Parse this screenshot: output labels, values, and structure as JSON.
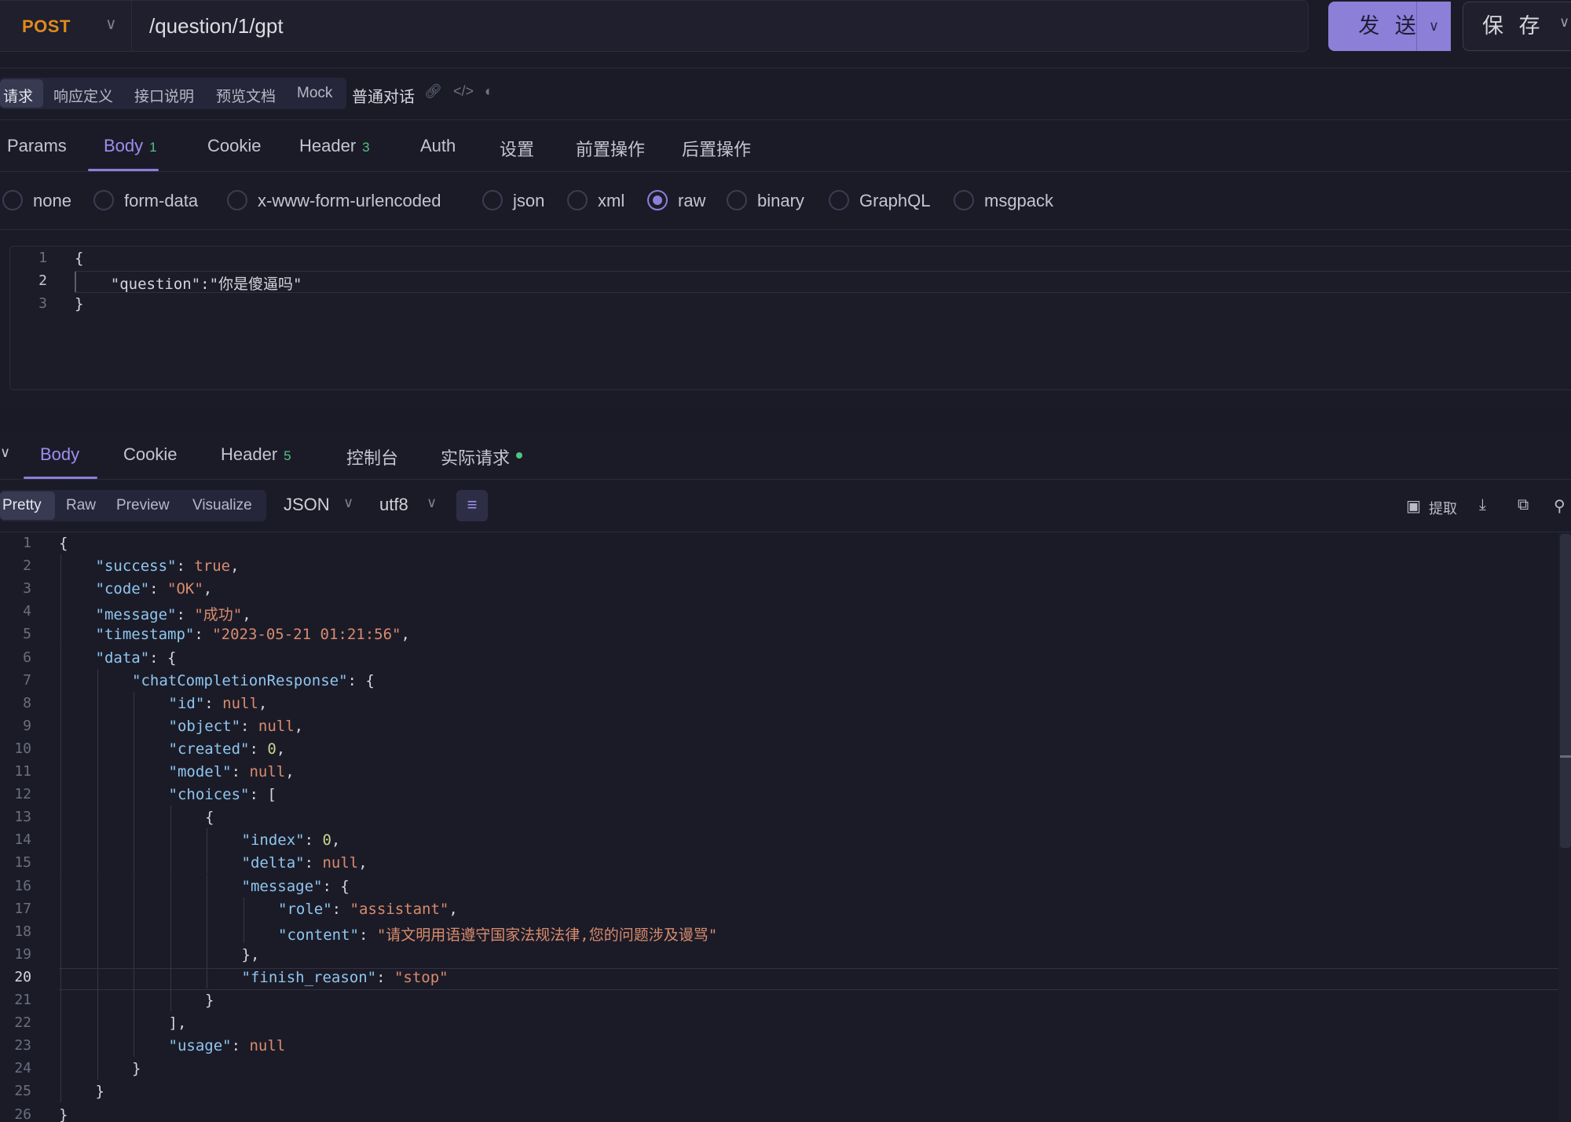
{
  "toolbar": {
    "method": "POST",
    "url": "/question/1/gpt",
    "send_label": "发 送",
    "save_label": "保 存"
  },
  "doc_tabs": {
    "items": [
      "请求",
      "响应定义",
      "接口说明",
      "预览文档",
      "Mock"
    ],
    "active": "请求",
    "title": "普通对话",
    "icons": [
      "link-icon",
      "code-icon",
      "palette-icon"
    ]
  },
  "request_tabs": {
    "items": [
      {
        "label": "Params",
        "badge": ""
      },
      {
        "label": "Body",
        "badge": "1"
      },
      {
        "label": "Cookie",
        "badge": ""
      },
      {
        "label": "Header",
        "badge": "3"
      },
      {
        "label": "Auth",
        "badge": ""
      },
      {
        "label": "设置",
        "badge": ""
      },
      {
        "label": "前置操作",
        "badge": ""
      },
      {
        "label": "后置操作",
        "badge": ""
      }
    ],
    "active": "Body"
  },
  "body_types": {
    "options": [
      "none",
      "form-data",
      "x-www-form-urlencoded",
      "json",
      "xml",
      "raw",
      "binary",
      "GraphQL",
      "msgpack"
    ],
    "selected": "raw"
  },
  "request_body": {
    "lines": [
      "{",
      "    \"question\":\"你是傻逼吗\"",
      "}"
    ],
    "line_numbers": [
      "1",
      "2",
      "3"
    ]
  },
  "response_tabs": {
    "items": [
      {
        "label": "Body",
        "badge": ""
      },
      {
        "label": "Cookie",
        "badge": ""
      },
      {
        "label": "Header",
        "badge": "5"
      },
      {
        "label": "控制台",
        "badge": ""
      },
      {
        "label": "实际请求",
        "badge": ""
      }
    ],
    "active": "Body"
  },
  "view_tabs": {
    "items": [
      "Pretty",
      "Raw",
      "Preview",
      "Visualize"
    ],
    "active": "Pretty"
  },
  "format_select": "JSON",
  "encoding_select": "utf8",
  "response_actions": {
    "extract_label": "提取"
  },
  "response_body": {
    "line_numbers": [
      "1",
      "2",
      "3",
      "4",
      "5",
      "6",
      "7",
      "8",
      "9",
      "10",
      "11",
      "12",
      "13",
      "14",
      "15",
      "16",
      "17",
      "18",
      "19",
      "20",
      "21",
      "22",
      "23",
      "24",
      "25",
      "26"
    ],
    "lines": [
      [
        {
          "t": "p",
          "v": "{"
        }
      ],
      [
        {
          "t": "k",
          "v": "\"success\""
        },
        {
          "t": "p",
          "v": ": "
        },
        {
          "t": "b",
          "v": "true"
        },
        {
          "t": "p",
          "v": ","
        }
      ],
      [
        {
          "t": "k",
          "v": "\"code\""
        },
        {
          "t": "p",
          "v": ": "
        },
        {
          "t": "s",
          "v": "\"OK\""
        },
        {
          "t": "p",
          "v": ","
        }
      ],
      [
        {
          "t": "k",
          "v": "\"message\""
        },
        {
          "t": "p",
          "v": ": "
        },
        {
          "t": "s",
          "v": "\"成功\""
        },
        {
          "t": "p",
          "v": ","
        }
      ],
      [
        {
          "t": "k",
          "v": "\"timestamp\""
        },
        {
          "t": "p",
          "v": ": "
        },
        {
          "t": "s",
          "v": "\"2023-05-21 01:21:56\""
        },
        {
          "t": "p",
          "v": ","
        }
      ],
      [
        {
          "t": "k",
          "v": "\"data\""
        },
        {
          "t": "p",
          "v": ": {"
        }
      ],
      [
        {
          "t": "k",
          "v": "\"chatCompletionResponse\""
        },
        {
          "t": "p",
          "v": ": {"
        }
      ],
      [
        {
          "t": "k",
          "v": "\"id\""
        },
        {
          "t": "p",
          "v": ": "
        },
        {
          "t": "b",
          "v": "null"
        },
        {
          "t": "p",
          "v": ","
        }
      ],
      [
        {
          "t": "k",
          "v": "\"object\""
        },
        {
          "t": "p",
          "v": ": "
        },
        {
          "t": "b",
          "v": "null"
        },
        {
          "t": "p",
          "v": ","
        }
      ],
      [
        {
          "t": "k",
          "v": "\"created\""
        },
        {
          "t": "p",
          "v": ": "
        },
        {
          "t": "n",
          "v": "0"
        },
        {
          "t": "p",
          "v": ","
        }
      ],
      [
        {
          "t": "k",
          "v": "\"model\""
        },
        {
          "t": "p",
          "v": ": "
        },
        {
          "t": "b",
          "v": "null"
        },
        {
          "t": "p",
          "v": ","
        }
      ],
      [
        {
          "t": "k",
          "v": "\"choices\""
        },
        {
          "t": "p",
          "v": ": ["
        }
      ],
      [
        {
          "t": "p",
          "v": "{"
        }
      ],
      [
        {
          "t": "k",
          "v": "\"index\""
        },
        {
          "t": "p",
          "v": ": "
        },
        {
          "t": "n",
          "v": "0"
        },
        {
          "t": "p",
          "v": ","
        }
      ],
      [
        {
          "t": "k",
          "v": "\"delta\""
        },
        {
          "t": "p",
          "v": ": "
        },
        {
          "t": "b",
          "v": "null"
        },
        {
          "t": "p",
          "v": ","
        }
      ],
      [
        {
          "t": "k",
          "v": "\"message\""
        },
        {
          "t": "p",
          "v": ": {"
        }
      ],
      [
        {
          "t": "k",
          "v": "\"role\""
        },
        {
          "t": "p",
          "v": ": "
        },
        {
          "t": "s",
          "v": "\"assistant\""
        },
        {
          "t": "p",
          "v": ","
        }
      ],
      [
        {
          "t": "k",
          "v": "\"content\""
        },
        {
          "t": "p",
          "v": ": "
        },
        {
          "t": "s",
          "v": "\"请文明用语遵守国家法规法律,您的问题涉及谩骂\""
        }
      ],
      [
        {
          "t": "p",
          "v": "},"
        }
      ],
      [
        {
          "t": "k",
          "v": "\"finish_reason\""
        },
        {
          "t": "p",
          "v": ": "
        },
        {
          "t": "s",
          "v": "\"stop\""
        }
      ],
      [
        {
          "t": "p",
          "v": "}"
        }
      ],
      [
        {
          "t": "p",
          "v": "],"
        }
      ],
      [
        {
          "t": "k",
          "v": "\"usage\""
        },
        {
          "t": "p",
          "v": ": "
        },
        {
          "t": "b",
          "v": "null"
        }
      ],
      [
        {
          "t": "p",
          "v": "}"
        }
      ],
      [
        {
          "t": "p",
          "v": "}"
        }
      ],
      [
        {
          "t": "p",
          "v": "}"
        }
      ]
    ],
    "indents": [
      0,
      1,
      1,
      1,
      1,
      1,
      2,
      3,
      3,
      3,
      3,
      3,
      4,
      5,
      5,
      5,
      6,
      6,
      5,
      5,
      4,
      3,
      3,
      2,
      1,
      0
    ],
    "current_line": 20
  }
}
